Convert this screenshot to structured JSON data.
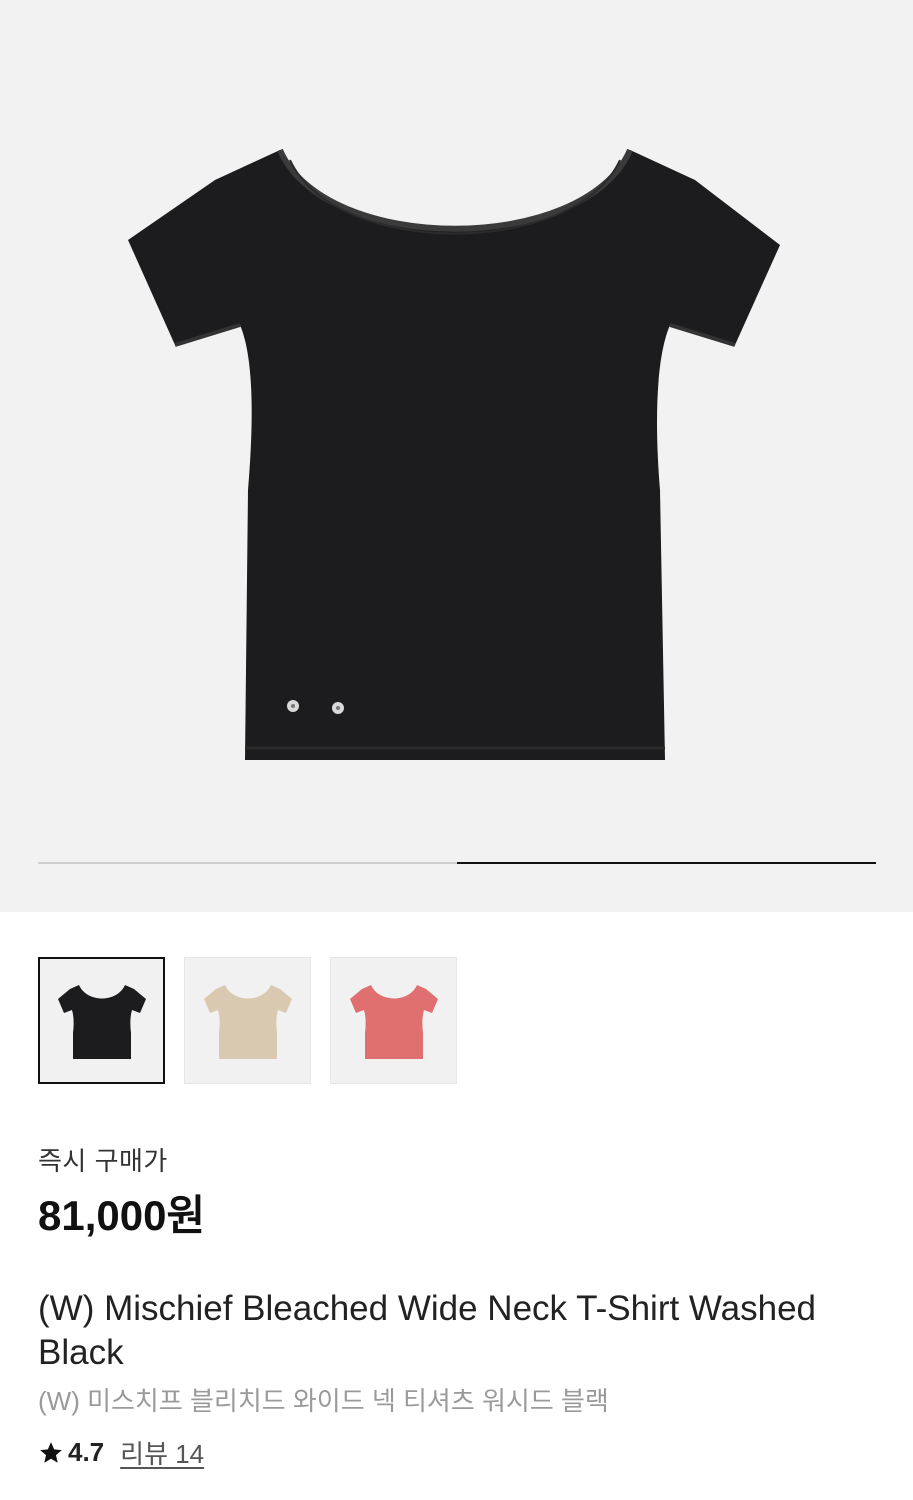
{
  "product": {
    "images": {
      "count": 2,
      "current_index": 2,
      "progress_fraction": 0.5
    },
    "thumbnails": [
      {
        "color_name": "black",
        "hex": "#1c1c1e",
        "selected": true
      },
      {
        "color_name": "beige",
        "hex": "#d9c9b0",
        "selected": false
      },
      {
        "color_name": "pink",
        "hex": "#e0706f",
        "selected": false
      }
    ],
    "price_label": "즉시 구매가",
    "price": "81,000원",
    "title_en": "(W) Mischief Bleached Wide Neck T-Shirt Washed Black",
    "title_ko": "(W) 미스치프 블리치드 와이드 넥 티셔츠 워시드 블랙",
    "rating": "4.7",
    "review_text": "리뷰 14"
  },
  "colors": {
    "hero_bg": "#f2f2f2",
    "shirt_main": "#1c1c1e"
  },
  "icons": {
    "star": "star-icon"
  }
}
